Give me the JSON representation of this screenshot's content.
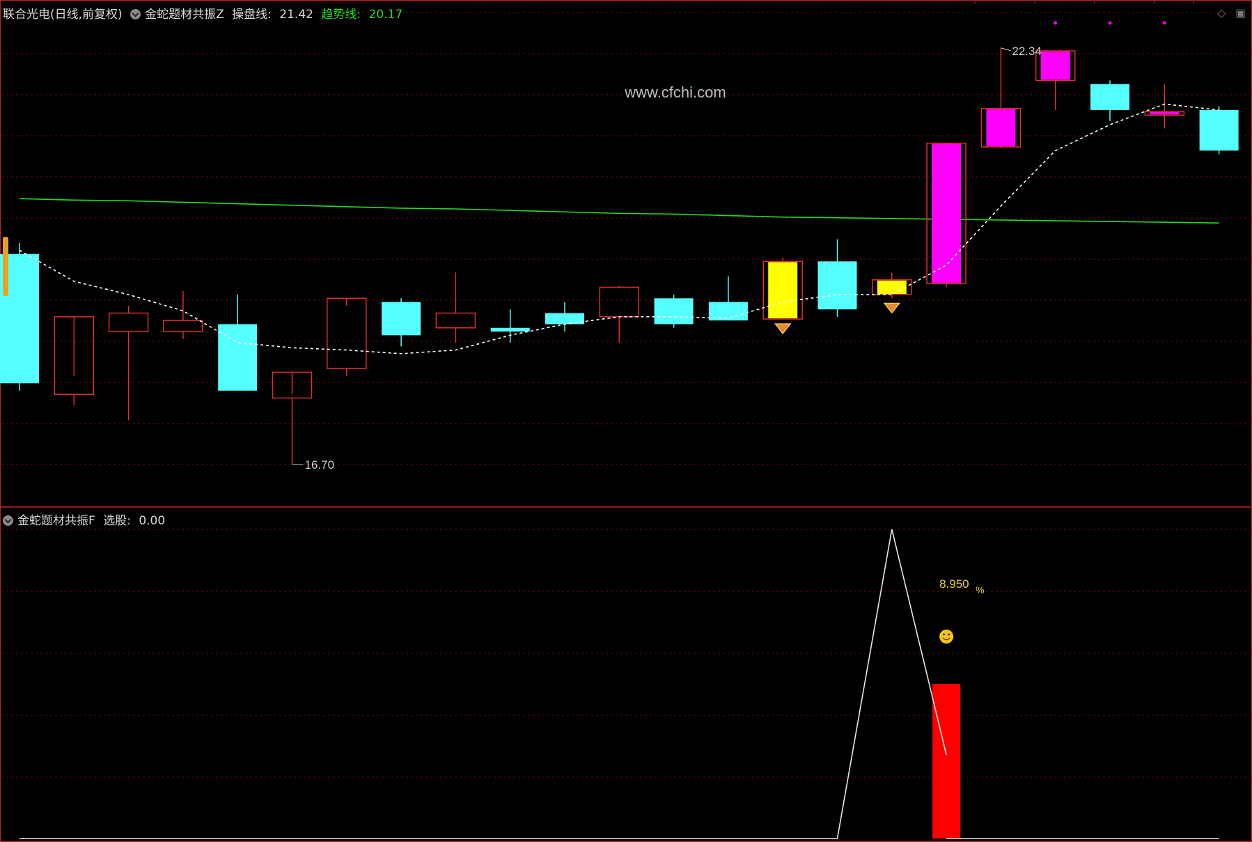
{
  "header_top": {
    "stock_title": "联合光电(日线,前复权)",
    "indicator_name": "金蛇题材共振Z",
    "line1_label": "操盘线",
    "line1_value": "21.42",
    "line2_label": "趋势线",
    "line2_value": "20.17"
  },
  "header_bottom": {
    "indicator_name": "金蛇题材共振F",
    "pick_label": "选股",
    "pick_value": "0.00"
  },
  "watermark": "www.cfchi.com",
  "colors": {
    "background": "#000000",
    "grid": "#5a0f0f",
    "frame": "#c22222",
    "up_candle": "#e03030",
    "down_candle": "#55ffff",
    "yellow_candle": "#ffff00",
    "magenta_candle": "#ff00ff",
    "trend_line": "#22dd22",
    "operating_line": "#ffffff",
    "signal_bar": "#ff0000"
  },
  "chart_data": [
    {
      "type": "candlestick",
      "title": "联合光电(日线,前复权)",
      "ylim": [
        16.2,
        22.8
      ],
      "high_label": "22.34",
      "low_label": "16.70",
      "candles": [
        {
          "o": 19.55,
          "h": 19.7,
          "l": 17.7,
          "c": 17.8,
          "style": "down"
        },
        {
          "o": 17.65,
          "h": 17.9,
          "l": 17.5,
          "c": 18.7,
          "style": "up"
        },
        {
          "o": 18.5,
          "h": 18.85,
          "l": 17.3,
          "c": 18.75,
          "style": "up"
        },
        {
          "o": 18.5,
          "h": 19.05,
          "l": 18.4,
          "c": 18.65,
          "style": "up"
        },
        {
          "o": 18.6,
          "h": 19.0,
          "l": 17.9,
          "c": 17.7,
          "style": "down"
        },
        {
          "o": 17.6,
          "h": 17.65,
          "l": 16.7,
          "c": 17.95,
          "style": "up"
        },
        {
          "o": 18.0,
          "h": 18.85,
          "l": 17.9,
          "c": 18.95,
          "style": "up"
        },
        {
          "o": 18.9,
          "h": 18.95,
          "l": 18.3,
          "c": 18.45,
          "style": "down"
        },
        {
          "o": 18.55,
          "h": 19.3,
          "l": 18.35,
          "c": 18.75,
          "style": "up"
        },
        {
          "o": 18.55,
          "h": 18.8,
          "l": 18.35,
          "c": 18.5,
          "style": "down"
        },
        {
          "o": 18.75,
          "h": 18.9,
          "l": 18.5,
          "c": 18.6,
          "style": "down"
        },
        {
          "o": 18.7,
          "h": 19.12,
          "l": 18.35,
          "c": 19.1,
          "style": "up"
        },
        {
          "o": 18.95,
          "h": 19.0,
          "l": 18.55,
          "c": 18.6,
          "style": "down"
        },
        {
          "o": 18.9,
          "h": 19.25,
          "l": 18.65,
          "c": 18.65,
          "style": "down"
        },
        {
          "o": 18.67,
          "h": 19.5,
          "l": 18.67,
          "c": 19.45,
          "style": "yellow"
        },
        {
          "o": 19.45,
          "h": 19.75,
          "l": 18.7,
          "c": 18.8,
          "style": "down"
        },
        {
          "o": 19.0,
          "h": 19.3,
          "l": 18.95,
          "c": 19.2,
          "style": "yellow"
        },
        {
          "o": 19.15,
          "h": 21.05,
          "l": 19.1,
          "c": 21.05,
          "style": "magenta"
        },
        {
          "o": 21.0,
          "h": 22.34,
          "l": 20.98,
          "c": 21.52,
          "style": "magenta"
        },
        {
          "o": 21.9,
          "h": 22.0,
          "l": 21.5,
          "c": 22.3,
          "style": "magenta"
        },
        {
          "o": 21.85,
          "h": 21.9,
          "l": 21.35,
          "c": 21.5,
          "style": "down"
        },
        {
          "o": 21.48,
          "h": 21.85,
          "l": 21.25,
          "c": 21.43,
          "style": "magenta"
        },
        {
          "o": 21.5,
          "h": 21.55,
          "l": 20.9,
          "c": 20.95,
          "style": "down"
        }
      ],
      "series": [
        {
          "name": "操盘线",
          "style": "dashed",
          "color": "#ffffff",
          "values": [
            19.6,
            19.18,
            19.0,
            18.78,
            18.35,
            18.28,
            18.25,
            18.2,
            18.25,
            18.45,
            18.6,
            18.7,
            18.7,
            18.68,
            18.9,
            19.0,
            19.0,
            19.4,
            20.2,
            20.95,
            21.3,
            21.58,
            21.5
          ]
        },
        {
          "name": "趋势线",
          "style": "solid",
          "color": "#22dd22",
          "values": [
            20.3,
            20.28,
            20.27,
            20.25,
            20.23,
            20.21,
            20.19,
            20.17,
            20.16,
            20.14,
            20.12,
            20.1,
            20.09,
            20.07,
            20.05,
            20.04,
            20.03,
            20.02,
            20.01,
            20.0,
            19.99,
            19.98,
            19.97
          ]
        }
      ],
      "signal_markers": [
        14,
        16
      ],
      "top_dots": [
        19,
        20,
        21
      ]
    },
    {
      "type": "line",
      "title": "金蛇题材共振F",
      "ylim": [
        0,
        1
      ],
      "x": [
        0,
        1,
        2,
        3,
        4,
        5,
        6,
        7,
        8,
        9,
        10,
        11,
        12,
        13,
        14,
        15,
        16,
        17,
        18,
        19,
        20,
        21,
        22
      ],
      "series": [
        {
          "name": "选股",
          "color": "#e8e8e8",
          "values": [
            0,
            0,
            0,
            0,
            0,
            0,
            0,
            0,
            0,
            0,
            0,
            0,
            0,
            0,
            0,
            0,
            1,
            0.27,
            null,
            null,
            null,
            null,
            0
          ]
        }
      ],
      "bar": {
        "index": 17,
        "value": 0.5,
        "color": "#ff0000"
      },
      "annotation": {
        "text": "8.950",
        "suffix": "%",
        "index": 17
      },
      "smiley_index": 17
    }
  ]
}
